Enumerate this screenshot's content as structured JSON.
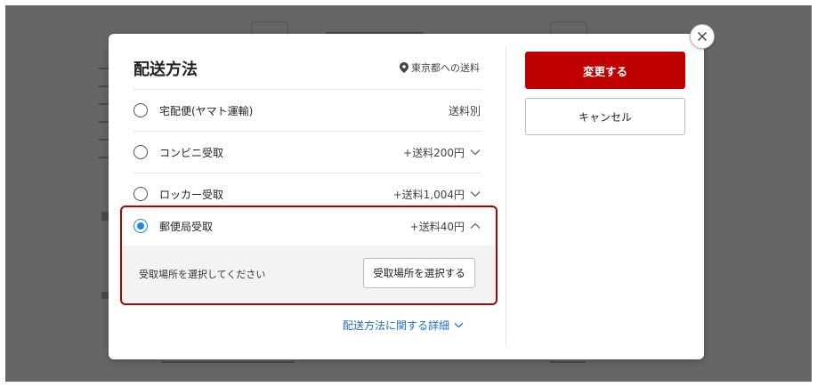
{
  "modal": {
    "title": "配送方法",
    "location_note": "東京都への送料",
    "options": [
      {
        "label": "宅配便(ヤマト運輸)",
        "fee": "送料別",
        "selected": false
      },
      {
        "label": "コンビニ受取",
        "fee": "+送料200円",
        "selected": false
      },
      {
        "label": "ロッカー受取",
        "fee": "+送料1,004円",
        "selected": false
      },
      {
        "label": "郵便局受取",
        "fee": "+送料40円",
        "selected": true
      }
    ],
    "selected_panel": {
      "instruction": "受取場所を選択してください",
      "button_label": "受取場所を選択する"
    },
    "details_link": "配送方法に関する詳細",
    "confirm_label": "変更する",
    "cancel_label": "キャンセル"
  },
  "colors": {
    "accent_red": "#c00000",
    "radio_blue": "#1e88e5",
    "link_blue": "#1e6fd0"
  }
}
